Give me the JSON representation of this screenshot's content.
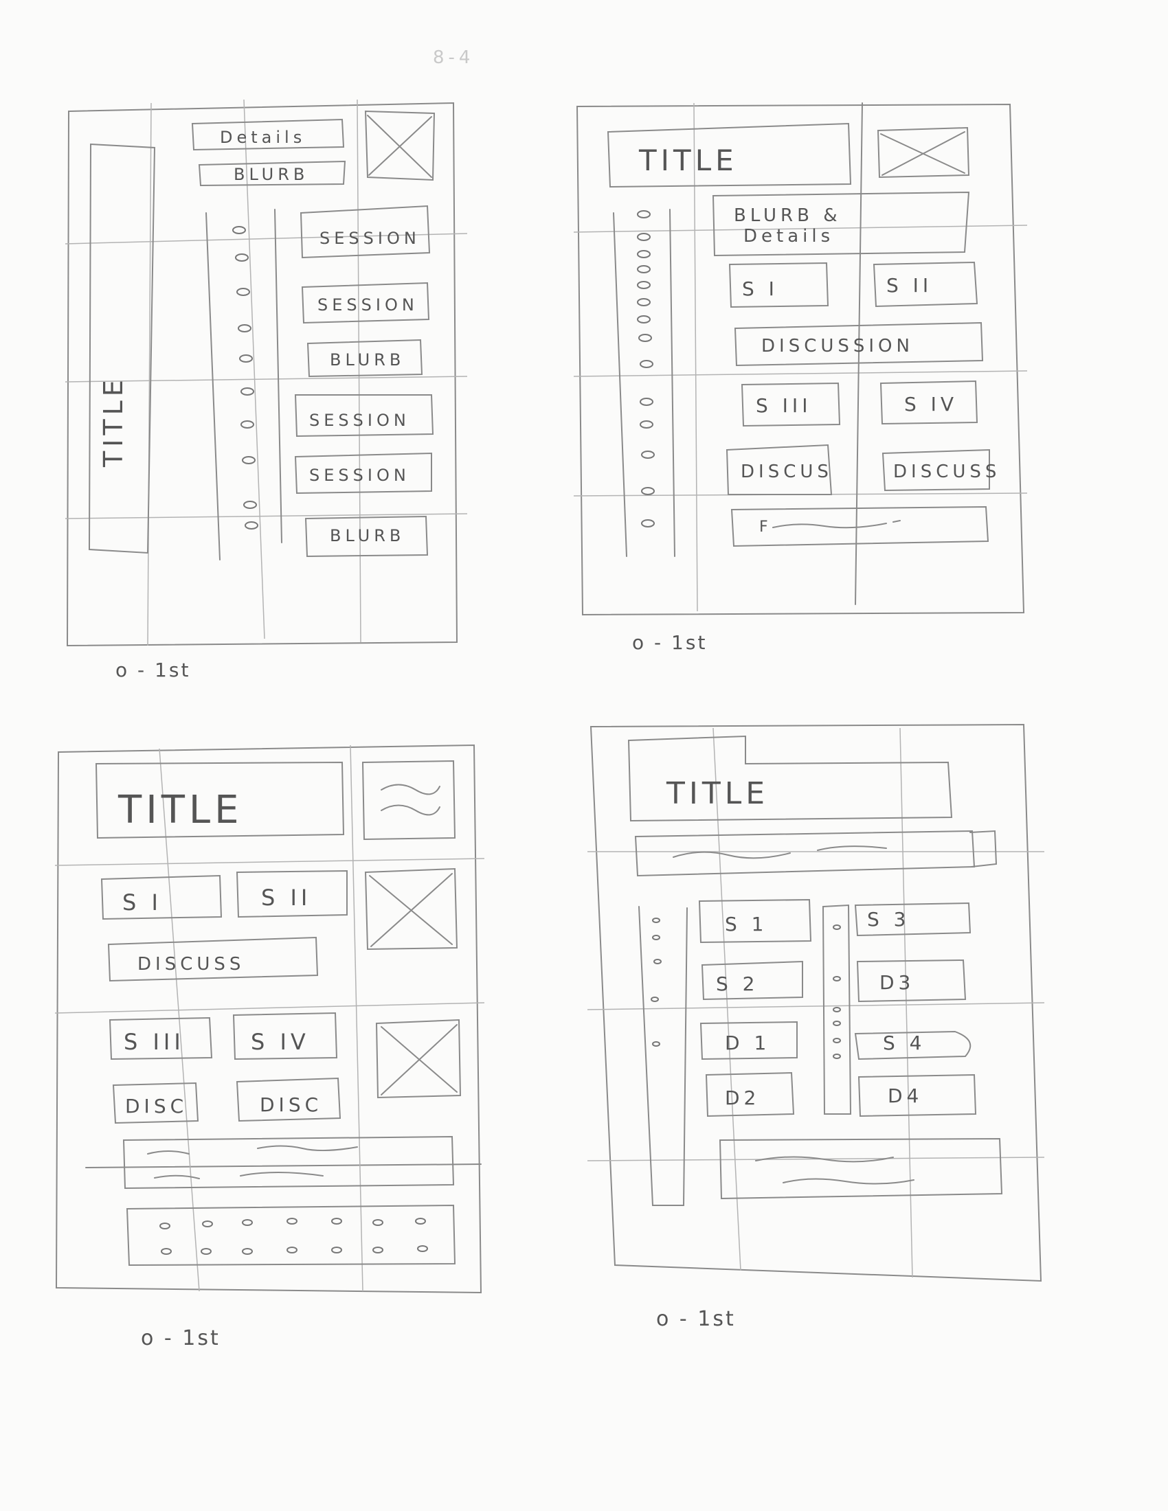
{
  "page_header": "8-4",
  "sketches": [
    {
      "caption": "o - 1st",
      "boxes": {
        "title": "TITLE",
        "details": "Details",
        "blurb_top": "BLURB",
        "session_1": "SESSION",
        "session_2": "SESSION",
        "blurb_mid": "BLURB",
        "session_3": "SESSION",
        "session_4": "SESSION",
        "blurb_bottom": "BLURB"
      }
    },
    {
      "caption": "o - 1st",
      "boxes": {
        "title": "TITLE",
        "blurb_details_1": "BLURB &",
        "blurb_details_2": "Details",
        "s1": "S I",
        "s2": "S II",
        "discussion": "DISCUSSION",
        "s3": "S III",
        "s4": "S IV",
        "discus_1": "DISCUS",
        "discus_2": "DISCUSS",
        "footer_scribble": "F"
      }
    },
    {
      "caption": "o - 1st",
      "boxes": {
        "title": "TITLE",
        "s1": "S I",
        "s2": "S II",
        "discussion": "DISCUSS",
        "s3": "S III",
        "s4": "S IV",
        "disc_1": "DISC",
        "disc_2": "DISC"
      }
    },
    {
      "caption": "o - 1st",
      "boxes": {
        "title": "TITLE",
        "s1": "S 1",
        "s2": "S 2",
        "d1": "D 1",
        "d2": "D2",
        "s3": "S 3",
        "d3": "D3",
        "s4": "S 4",
        "d4": "D4"
      }
    }
  ]
}
